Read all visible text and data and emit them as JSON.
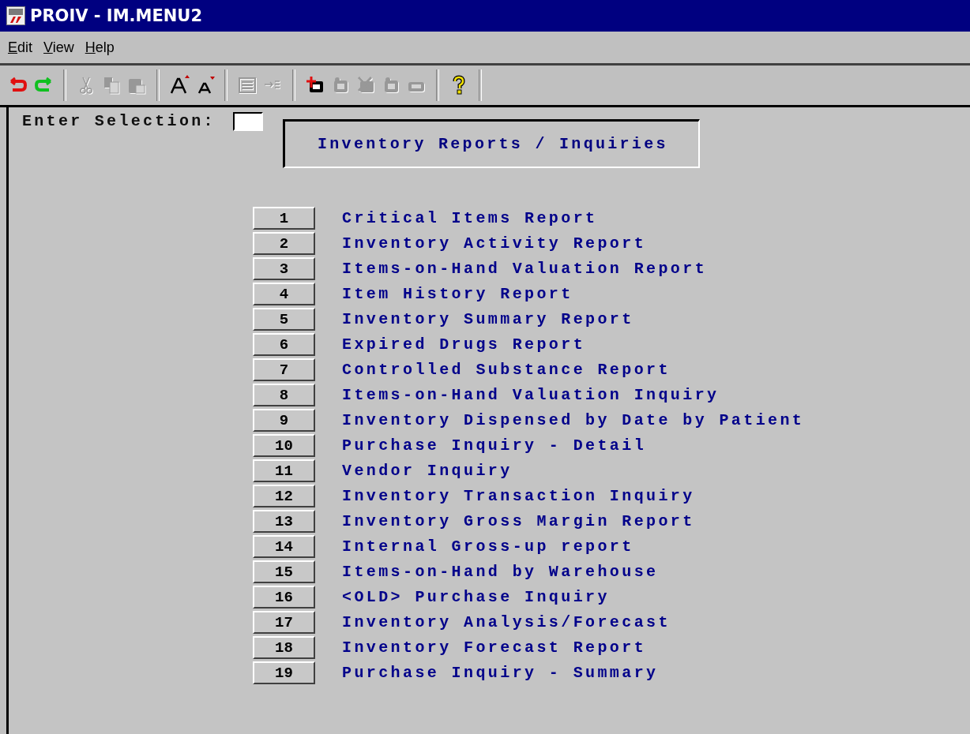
{
  "window": {
    "title": "PROIV - IM.MENU2"
  },
  "menu_bar": [
    "Edit",
    "View",
    "Help"
  ],
  "toolbar": [
    {
      "kind": "undo",
      "disabled": false
    },
    {
      "kind": "redo",
      "disabled": false
    },
    {
      "kind": "separator"
    },
    {
      "kind": "cut",
      "disabled": true
    },
    {
      "kind": "copy",
      "disabled": true
    },
    {
      "kind": "paste",
      "disabled": true
    },
    {
      "kind": "separator"
    },
    {
      "kind": "font-larger",
      "disabled": false
    },
    {
      "kind": "font-smaller",
      "disabled": false
    },
    {
      "kind": "separator"
    },
    {
      "kind": "list",
      "disabled": true
    },
    {
      "kind": "tab",
      "disabled": true
    },
    {
      "kind": "separator"
    },
    {
      "kind": "record-add",
      "disabled": false
    },
    {
      "kind": "record",
      "disabled": true
    },
    {
      "kind": "record-delete",
      "disabled": true
    },
    {
      "kind": "record",
      "disabled": true
    },
    {
      "kind": "printer",
      "disabled": true
    },
    {
      "kind": "separator"
    },
    {
      "kind": "help",
      "disabled": false
    },
    {
      "kind": "separator"
    }
  ],
  "selection": {
    "label": "Enter Selection:"
  },
  "heading": "Inventory Reports / Inquiries",
  "options": [
    {
      "number": "1",
      "label": "Critical Items Report"
    },
    {
      "number": "2",
      "label": "Inventory Activity Report"
    },
    {
      "number": "3",
      "label": "Items-on-Hand Valuation Report"
    },
    {
      "number": "4",
      "label": "Item History Report"
    },
    {
      "number": "5",
      "label": "Inventory Summary Report"
    },
    {
      "number": "6",
      "label": "Expired Drugs Report"
    },
    {
      "number": "7",
      "label": "Controlled Substance Report"
    },
    {
      "number": "8",
      "label": "Items-on-Hand Valuation Inquiry"
    },
    {
      "number": "9",
      "label": "Inventory Dispensed by Date by Patient"
    },
    {
      "number": "10",
      "label": "Purchase Inquiry - Detail"
    },
    {
      "number": "11",
      "label": "Vendor Inquiry"
    },
    {
      "number": "12",
      "label": "Inventory Transaction Inquiry"
    },
    {
      "number": "13",
      "label": "Inventory Gross Margin Report"
    },
    {
      "number": "14",
      "label": "Internal Gross-up report"
    },
    {
      "number": "15",
      "label": "Items-on-Hand by Warehouse"
    },
    {
      "number": "16",
      "label": "<OLD> Purchase Inquiry"
    },
    {
      "number": "17",
      "label": "Inventory Analysis/Forecast"
    },
    {
      "number": "18",
      "label": "Inventory Forecast Report"
    },
    {
      "number": "19",
      "label": "Purchase Inquiry - Summary"
    }
  ]
}
